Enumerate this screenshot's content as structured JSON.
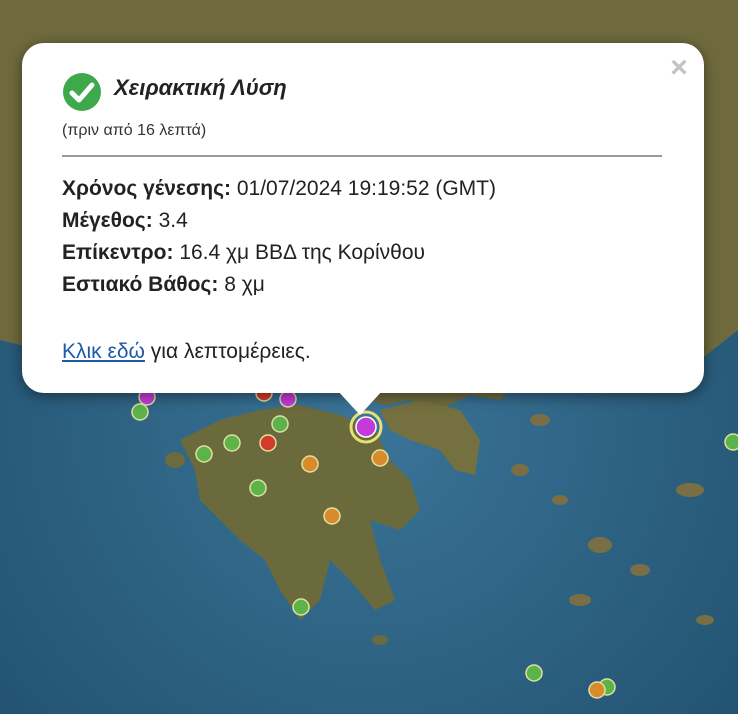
{
  "popup": {
    "title": "Χειρακτική Λύση",
    "time_ago": "(πριν από 16 λεπτά)",
    "close_symbol": "×",
    "status_icon": "check-circle-icon",
    "fields": [
      {
        "label": "Χρόνος γένεσης:",
        "value": "01/07/2024 19:19:52 (GMT)"
      },
      {
        "label": "Μέγεθος:",
        "value": "3.4"
      },
      {
        "label": "Επίκεντρο:",
        "value": "16.4 χμ ΒΒΔ της Κορίνθου"
      },
      {
        "label": "Εστιακό Βάθος:",
        "value": "8 χμ"
      }
    ],
    "link_text": "Κλικ εδώ",
    "link_suffix": " για λεπτομέρειες."
  },
  "colors": {
    "sea": "#2a5f80",
    "land": "#6f6a3e",
    "selected_marker": "#c23bd6",
    "marker_green": "#5cb34a",
    "marker_orange": "#d98b2b",
    "marker_red": "#d43a2a",
    "marker_magenta": "#c23bd6",
    "check_green": "#3ea94a",
    "link": "#1f5aa6"
  },
  "markers": [
    {
      "type": "selected",
      "color": "magenta"
    },
    {
      "type": "quake",
      "color": "green"
    },
    {
      "type": "quake",
      "color": "green"
    },
    {
      "type": "quake",
      "color": "green"
    },
    {
      "type": "quake",
      "color": "green"
    },
    {
      "type": "quake",
      "color": "green"
    },
    {
      "type": "quake",
      "color": "green"
    },
    {
      "type": "quake",
      "color": "green"
    },
    {
      "type": "quake",
      "color": "green"
    },
    {
      "type": "quake",
      "color": "green"
    },
    {
      "type": "quake",
      "color": "red"
    },
    {
      "type": "quake",
      "color": "red"
    },
    {
      "type": "quake",
      "color": "orange"
    },
    {
      "type": "quake",
      "color": "orange"
    },
    {
      "type": "quake",
      "color": "orange"
    },
    {
      "type": "quake",
      "color": "orange"
    },
    {
      "type": "quake",
      "color": "magenta"
    },
    {
      "type": "quake",
      "color": "magenta"
    }
  ]
}
